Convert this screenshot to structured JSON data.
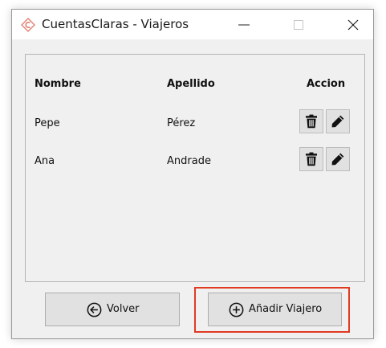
{
  "window": {
    "title": "CuentasClaras - Viajeros",
    "controls": {
      "minimize_icon": "minimize-icon",
      "maximize_icon": "maximize-icon",
      "close_icon": "close-icon"
    }
  },
  "table": {
    "headers": {
      "nombre": "Nombre",
      "apellido": "Apellido",
      "accion": "Accion"
    },
    "rows": [
      {
        "nombre": "Pepe",
        "apellido": "Pérez"
      },
      {
        "nombre": "Ana",
        "apellido": "Andrade"
      }
    ],
    "row_icons": {
      "delete": "trash-icon",
      "edit": "pencil-icon"
    }
  },
  "buttons": {
    "volver": {
      "label": "Volver",
      "icon": "arrow-left-circle-icon"
    },
    "add": {
      "label": "Añadir Viajero",
      "icon": "plus-circle-icon"
    }
  },
  "colors": {
    "window_bg": "#f0f0f0",
    "titlebar_bg": "#ffffff",
    "button_bg": "#e1e1e1",
    "highlight": "#e23a22",
    "app_icon": "#e07a6a"
  }
}
